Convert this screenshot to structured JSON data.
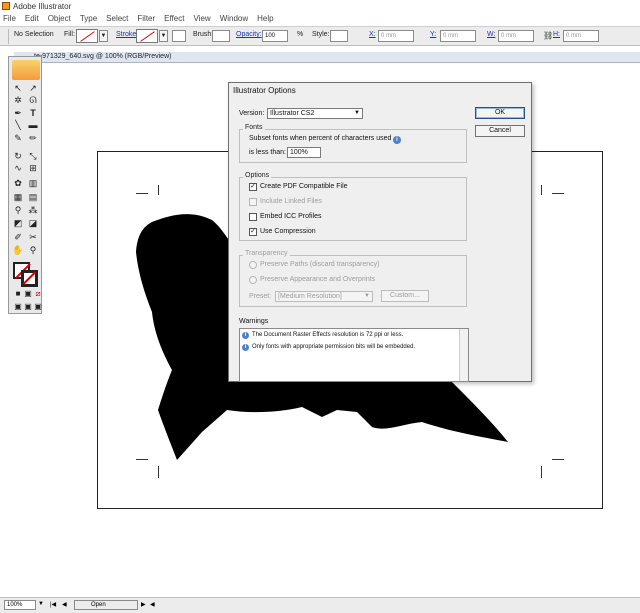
{
  "window": {
    "title": "Adobe Illustrator"
  },
  "menu": [
    "File",
    "Edit",
    "Object",
    "Type",
    "Select",
    "Filter",
    "Effect",
    "View",
    "Window",
    "Help"
  ],
  "control_bar": {
    "selection": "No Selection",
    "fill_label": "Fill:",
    "stroke_label": "Stroke:",
    "brush_label": "Brush:",
    "opacity_label": "Opacity:",
    "opacity_value": "100",
    "opacity_unit": "%",
    "style_label": "Style:",
    "x_label": "X:",
    "x_value": "0 mm",
    "y_label": "Y:",
    "y_value": "0 mm",
    "w_label": "W:",
    "w_value": "0 mm",
    "h_label": "H:",
    "h_value": "0 mm"
  },
  "document_tab": "te-971329_640.svg @ 100% (RGB/Preview)",
  "dialog": {
    "title": "Illustrator Options",
    "version_label": "Version:",
    "version_value": "Illustrator CS2",
    "ok": "OK",
    "cancel": "Cancel",
    "fonts": {
      "legend": "Fonts",
      "subset_label": "Subset fonts when percent of characters used",
      "is_less_than": "is less than:",
      "value": "100%"
    },
    "options": {
      "legend": "Options",
      "items": [
        {
          "label": "Create PDF Compatible File",
          "checked": true,
          "enabled": true
        },
        {
          "label": "Include Linked Files",
          "checked": false,
          "enabled": false
        },
        {
          "label": "Embed ICC Profiles",
          "checked": false,
          "enabled": true
        },
        {
          "label": "Use Compression",
          "checked": true,
          "enabled": true
        }
      ]
    },
    "transparency": {
      "legend": "Transparency",
      "preserve_paths": "Preserve Paths (discard transparency)",
      "preserve_appearance": "Preserve Appearance and Overprints",
      "preset_label": "Preset:",
      "preset_value": "[Medium Resolution]",
      "custom": "Custom..."
    },
    "warnings": {
      "legend": "Warnings",
      "items": [
        "The Document Raster Effects resolution is 72 ppi or less.",
        "Only fonts with appropriate permission bits will be embedded."
      ]
    }
  },
  "status_bar": {
    "zoom": "100%",
    "status": "Open"
  },
  "colors": {
    "dialog_bg": "#efefef",
    "artwork": "#000000",
    "accent_link": "#1a37a8"
  }
}
